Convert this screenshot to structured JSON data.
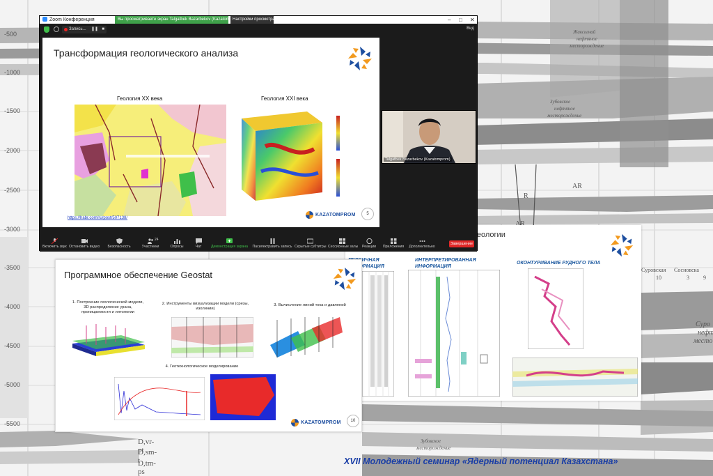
{
  "background": {
    "depth_labels": [
      "-500",
      "-1000",
      "-1500",
      "-2000",
      "-2500",
      "-3000",
      "-3500",
      "-4000",
      "-4500",
      "-5000",
      "-5500"
    ],
    "map_labels": {
      "ar_1": "AR",
      "ar_2": "AR",
      "rl": "R",
      "field_top_1": "Жаксымай",
      "field_top_2": "нефтяное",
      "field_top_3": "месторождение",
      "zubovskoe_1": "Зубовское",
      "zubovskoe_2": "нефтяное",
      "zubovskoe_3": "месторождение",
      "region_left": "Суровская",
      "region_right": "Сосновска",
      "tick_10": "10",
      "tick_3": "3",
      "tick_9": "9",
      "side_1": "Суро",
      "side_2": "нефт",
      "side_3": "место",
      "strat_1": "D,vr-pt",
      "strat_2": "D,sm-t",
      "strat_3": "D,tm-ps",
      "bottom_field_1": "Зубовское",
      "bottom_field_2": "месторождение"
    }
  },
  "zoom": {
    "title": "Zoom Конференция",
    "share_banner": "Вы просматриваете экран Talgatbek Bazarbekov (Kazatomprom)",
    "view_options": "Настройки просмотра",
    "recording": "Запись...",
    "view_label": "Вид",
    "toolbar": [
      "Включить звук",
      "Остановить видео",
      "Безопасность",
      "Участники",
      "Опросы",
      "Чат",
      "Демонстрация экрана",
      "Пасилектравить запись",
      "Скрытые субтитры",
      "Сессионные залы",
      "Реакции",
      "Приложения",
      "Дополнительно"
    ],
    "participants_count": "24",
    "end_button": "Завершение",
    "participant_name": "Talgatbek Bazarbekov (Kazatomprom)"
  },
  "slide1": {
    "title": "Трансформация геологического анализа",
    "left_caption": "Геология XX века",
    "right_caption": "Геология XXI века",
    "link": "https://habr.com/ru/post/507138/",
    "company": "KAZATOMPROM",
    "page": "5"
  },
  "slide2": {
    "title": "Программное обеспечение Geostat",
    "step1": "1. Построение геологической модели, 3D распределение урана, проницаемости и литологии",
    "step2": "2. Инструменты визуализации модели (срезы, изолинии)",
    "step3": "3. Вычисление линий тока и давлений",
    "step4": "4. Геотехнологическое моделирование",
    "company": "KAZATOMPROM",
    "page": "10"
  },
  "slide3": {
    "top_title": "Визуализация данных в геологии",
    "col1_line1": "ПЕРВИЧНАЯ",
    "col1_line2": "ИНФОРМАЦИЯ",
    "col2_line1": "ИНТЕРПРЕТИРОВАННАЯ",
    "col2_line2": "ИНФОРМАЦИЯ",
    "col3": "ОКОНТУРИВАНИЕ РУДНОГО ТЕЛА"
  },
  "footer": "XVII Молодежный семинар «Ядерный потенциал Казахстана»",
  "colors": {
    "kazatomprom_blue": "#1e4fa0",
    "kazatomprom_orange": "#f29a1f",
    "zoom_green": "#3fa14a",
    "end_red": "#e02828",
    "footer_blue": "#1b3fa6"
  }
}
